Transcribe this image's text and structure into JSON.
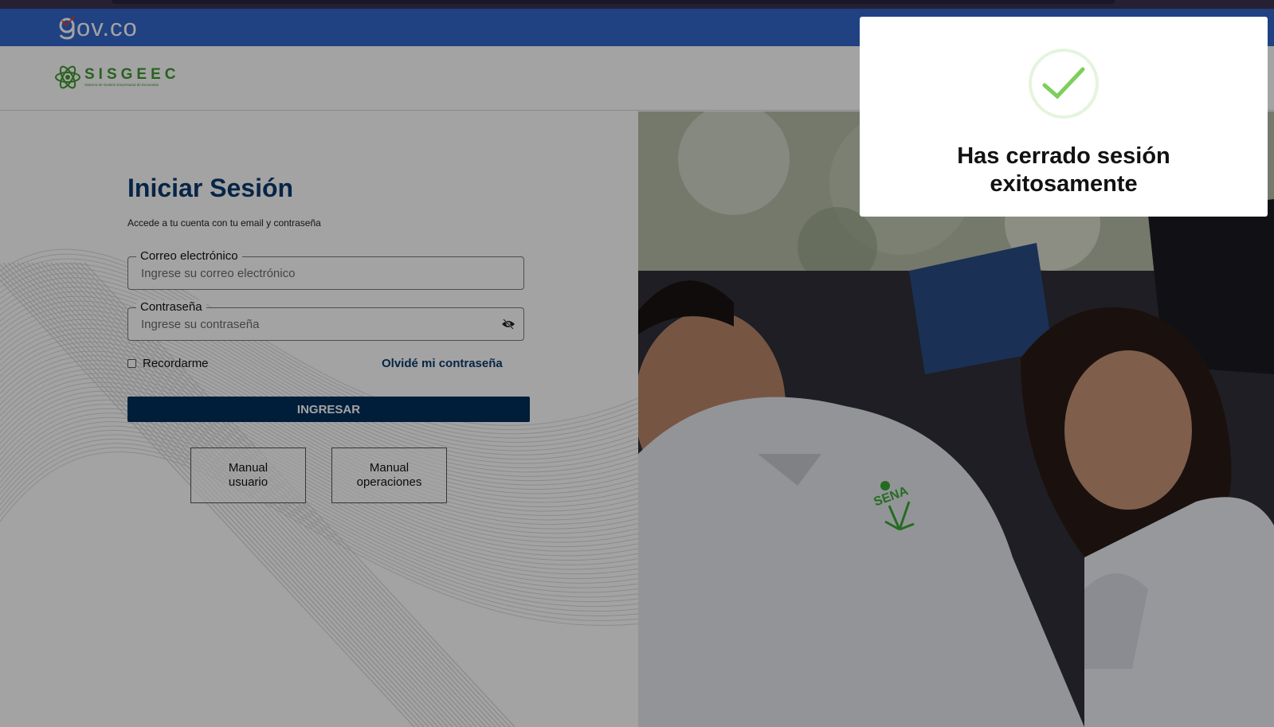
{
  "gov_bar": {
    "logo_text": "ov.co",
    "logo_mark": "g"
  },
  "header": {
    "brand_name": "SISGEEC",
    "brand_tagline": "Sistema de Gestión Empresarial de Encuestas",
    "logo_icon": "atom-icon"
  },
  "login": {
    "title": "Iniciar Sesión",
    "subtitle": "Accede a tu cuenta con tu email y contraseña",
    "email": {
      "label": "Correo electrónico",
      "placeholder": "Ingrese su correo electrónico",
      "value": ""
    },
    "password": {
      "label": "Contraseña",
      "placeholder": "Ingrese su contraseña",
      "value": "",
      "toggle_icon": "eye-slash-icon"
    },
    "remember_label": "Recordarme",
    "remember_checked": false,
    "forgot_label": "Olvidé mi contraseña",
    "submit_label": "INGRESAR",
    "manual_user_label": "Manual\nusuario",
    "manual_ops_label": "Manual\noperaciones"
  },
  "toast": {
    "message": "Has cerrado sesión\nexitosamente",
    "icon": "checkmark-circle-icon",
    "accent_color": "#7ccf5b"
  },
  "colors": {
    "gov_bar": "#3366cc",
    "title": "#0b3b6e",
    "primary_button": "#002f5c",
    "brand_green": "#3f9a2f"
  }
}
